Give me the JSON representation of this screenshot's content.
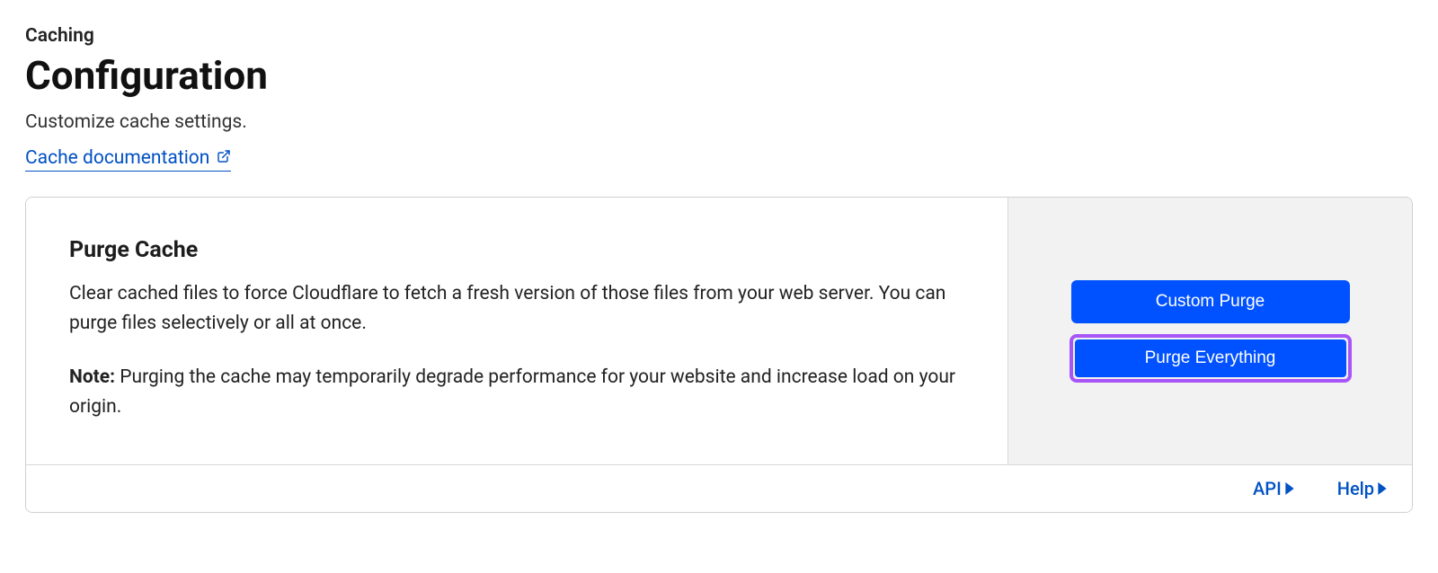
{
  "header": {
    "breadcrumb": "Caching",
    "title": "Configuration",
    "subtitle": "Customize cache settings.",
    "doc_link": "Cache documentation"
  },
  "purge": {
    "title": "Purge Cache",
    "description": "Clear cached files to force Cloudflare to fetch a fresh version of those files from your web server. You can purge files selectively or all at once.",
    "note_label": "Note:",
    "note_text": " Purging the cache may temporarily degrade performance for your website and increase load on your origin.",
    "custom_purge_label": "Custom Purge",
    "purge_everything_label": "Purge Everything"
  },
  "footer": {
    "api_label": "API",
    "help_label": "Help"
  }
}
